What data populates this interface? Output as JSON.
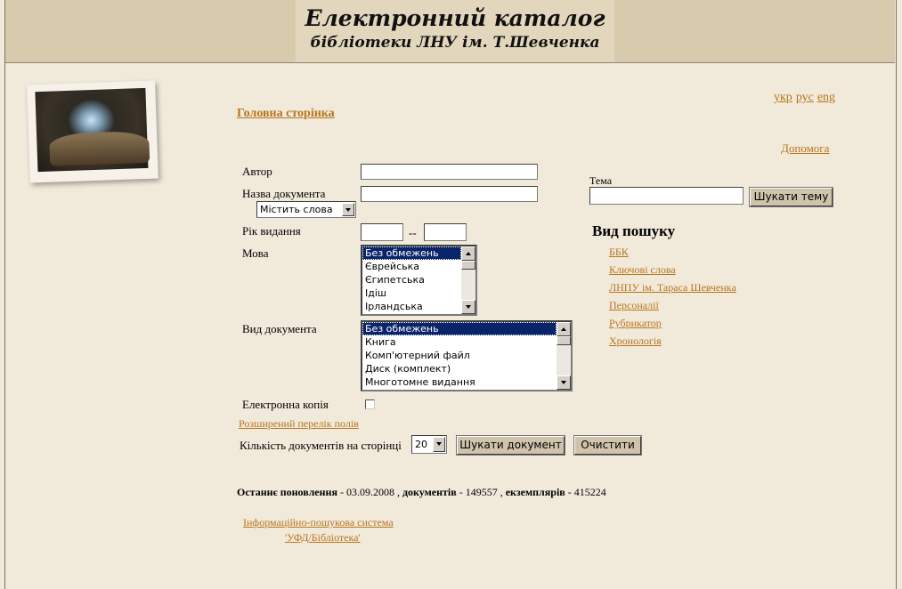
{
  "header": {
    "title": "Електронний каталог",
    "subtitle": "бібліотеки ЛНУ ім. Т.Шевченка"
  },
  "lang": {
    "ukr": "укр",
    "rus": "рус",
    "eng": "eng"
  },
  "nav": {
    "home": "Головна сторінка",
    "help": "Допомога"
  },
  "form": {
    "author_label": "Автор",
    "author_value": "",
    "title_label": "Назва документа",
    "title_value": "",
    "title_mode": "Містить слова",
    "year_label": "Рік видання",
    "year_from": "",
    "year_sep": "--",
    "year_to": "",
    "language_label": "Мова",
    "language_options": [
      "Без обмежень",
      "Єврейська",
      "Єгипетська",
      "Ідіш",
      "Ірландська"
    ],
    "doctype_label": "Вид документа",
    "doctype_options": [
      "Без обмежень",
      "Книга",
      "Комп'ютерний файл",
      "Диск (комплект)",
      "Многотомне видання"
    ],
    "ecopy_label": "Електронна копія",
    "ecopy_checked": false,
    "extended_link": "Розширений перелік полів",
    "per_page_label": "Кількість документів на сторінці",
    "per_page_value": "20",
    "search_button": "Шукати документ",
    "clear_button": "Очистити"
  },
  "topic": {
    "label": "Тема",
    "value": "",
    "button": "Шукати тему"
  },
  "search_type": {
    "title": "Вид пошуку",
    "items": [
      "ББК",
      "Ключові слова",
      "ЛНПУ ім. Тараса Шевченка",
      "Персоналії",
      "Рубрикатор",
      "Хронологія"
    ]
  },
  "footer": {
    "updated_label": "Останнє поновлення",
    "updated_value": " - 03.09.2008 , ",
    "docs_label": "документів",
    "docs_value": " - 149557 , ",
    "copies_label": "екземплярів",
    "copies_value": " - 415224",
    "system_line1": "Інформаційно-пошукова система",
    "system_line2": "'УФД/Бібліотека'"
  }
}
